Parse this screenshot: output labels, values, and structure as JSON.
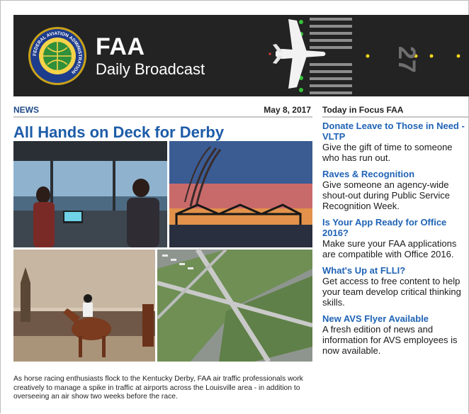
{
  "brand": {
    "title": "FAA",
    "subtitle": "Daily Broadcast",
    "seal_text": "FEDERAL AVIATION ADMINISTRATION",
    "runway_number": "27"
  },
  "news": {
    "section_label": "NEWS",
    "date": "May 8, 2017",
    "headline": "All Hands on Deck for Derby",
    "body": "As horse racing enthusiasts flock to the Kentucky Derby, FAA air traffic professionals work creatively to manage a spike in traffic at airports across the Louisville area - in addition to overseeing an air show two weeks before the race."
  },
  "sidebar": {
    "heading": "Today in Focus FAA",
    "items": [
      {
        "title": "Donate Leave to Those in Need - VLTP",
        "desc": "Give the gift of time to someone who has run out."
      },
      {
        "title": "Raves & Recognition",
        "desc": "Give someone an agency-wide shout-out during Public Service Recognition Week."
      },
      {
        "title": "Is Your App Ready for Office 2016?",
        "desc": "Make sure your FAA applications are compatible with Office 2016."
      },
      {
        "title": "What's Up at FLLI?",
        "desc": "Get access to free content to help your team develop critical thinking skills."
      },
      {
        "title": "New AVS Flyer Available",
        "desc": "A fresh edition of news and information for AVS employees is now available."
      }
    ]
  },
  "colors": {
    "banner": "#232323",
    "news_blue": "#1f4a8a",
    "headline_blue": "#1d5ca8",
    "link_blue": "#1f63b5",
    "runway_light": "#35c23a",
    "taxi_light": "#f2d21b"
  }
}
